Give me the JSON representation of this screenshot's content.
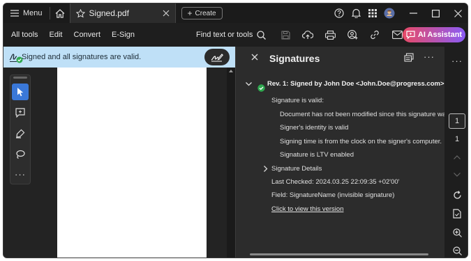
{
  "titlebar": {
    "menu_label": "Menu",
    "tab_label": "Signed.pdf",
    "create_label": "Create"
  },
  "toolbar": {
    "items": [
      "All tools",
      "Edit",
      "Convert",
      "E-Sign"
    ],
    "find_label": "Find text or tools",
    "ai_label": "AI Assistant"
  },
  "signature_bar": {
    "message": "Signed and all signatures are valid."
  },
  "panel": {
    "title": "Signatures",
    "revision": "Rev. 1: Signed by John Doe <John.Doe@progress.com>",
    "valid_heading": "Signature is valid:",
    "details": [
      "Document has not been modified since this signature was applied",
      "Signer's identity is valid",
      "Signing time is from the clock on the signer's computer.",
      "Signature is LTV enabled"
    ],
    "signature_details": "Signature Details",
    "last_checked": "Last Checked: 2024.03.25 22:09:35 +02'00'",
    "field": "Field: SignatureName (invisible signature)",
    "view_version": "Click to view this version"
  },
  "right_rail": {
    "current_page": "1",
    "total_pages": "1"
  },
  "colors": {
    "accent_blue": "#bfe0f7",
    "valid_green": "#2fa84f",
    "ai_gradient_start": "#e84a66",
    "ai_gradient_end": "#8a5cf6"
  }
}
